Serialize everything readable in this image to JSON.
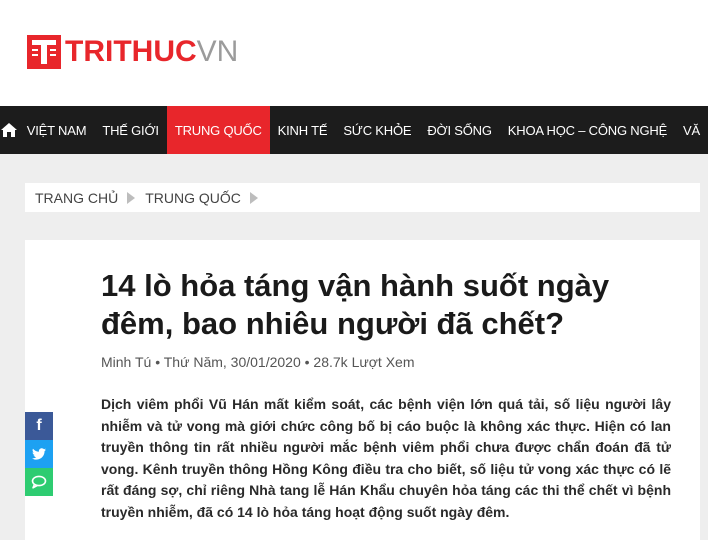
{
  "logo": {
    "text_red": "TRITHUC",
    "text_grey": "VN"
  },
  "nav": {
    "home_icon": "home-icon",
    "items": [
      "VIỆT NAM",
      "THẾ GIỚI",
      "TRUNG QUỐC",
      "KINH TẾ",
      "SỨC KHỎE",
      "ĐỜI SỐNG",
      "KHOA HỌC – CÔNG NGHỆ",
      "VĂ"
    ],
    "active": "TRUNG QUỐC",
    "active_color": "#e8262b"
  },
  "breadcrumb": {
    "items": [
      "TRANG CHỦ",
      "TRUNG QUỐC"
    ]
  },
  "article": {
    "title": "14 lò hỏa táng vận hành suốt ngày đêm, bao nhiêu người đã chết?",
    "meta": "Minh Tú • Thứ Năm, 30/01/2020 • 28.7k Lượt Xem",
    "lead": "Dịch viêm phổi Vũ Hán mất kiểm soát, các bệnh viện lớn quá tải, số liệu người lây nhiễm và tử vong mà giới chức công bố bị cáo buộc là không xác thực. Hiện có lan truyền thông tin rất nhiều người mắc bệnh viêm phổi chưa được chẩn đoán đã tử vong. Kênh truyền thông Hồng Kông điều tra cho biết, số liệu tử vong xác thực có lẽ rất đáng sợ, chỉ riêng Nhà tang lễ Hán Khẩu chuyên hỏa táng các thi thể chết vì bệnh truyền nhiễm, đã có 14 lò hỏa táng hoạt động suốt ngày đêm."
  },
  "share": {
    "facebook": "f",
    "icons": [
      "facebook-icon",
      "twitter-icon",
      "comment-icon"
    ]
  }
}
